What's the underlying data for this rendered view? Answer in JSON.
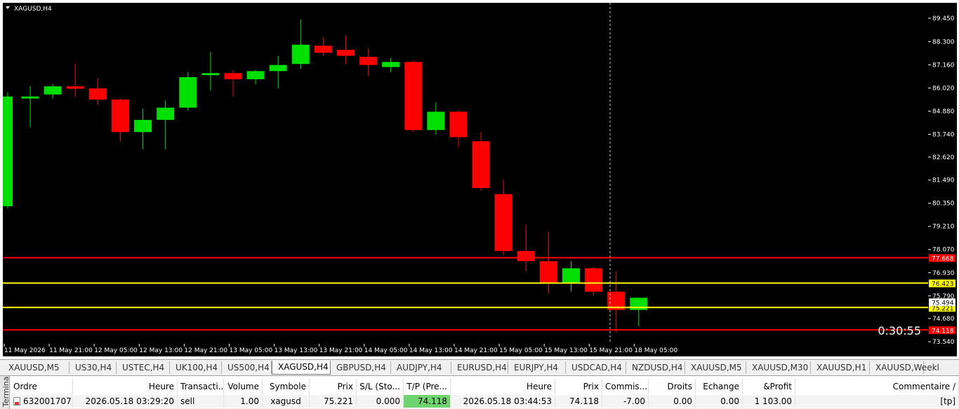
{
  "chart": {
    "title": "XAGUSD,H4",
    "countdown": "0:30:55",
    "background": "#000000",
    "up_color": "#00e000",
    "down_color": "#ff0000",
    "price_labels": [
      "89.450",
      "88.300",
      "87.160",
      "86.020",
      "84.880",
      "83.740",
      "82.620",
      "81.490",
      "80.350",
      "79.210",
      "78.070",
      "76.930",
      "75.790",
      "74.680",
      "73.540"
    ],
    "time_labels": [
      "11 May 2026",
      "11 May 21:00",
      "12 May 05:00",
      "12 May 13:00",
      "12 May 21:00",
      "13 May 05:00",
      "13 May 13:00",
      "13 May 21:00",
      "14 May 05:00",
      "14 May 13:00",
      "14 May 21:00",
      "15 May 05:00",
      "15 May 13:00",
      "15 May 21:00",
      "18 May 05:00"
    ],
    "level_lines": [
      {
        "price": 77.668,
        "label": "77.668",
        "color": "#ff0000",
        "label_bg": "#ff0000",
        "label_fg": "#ffffff"
      },
      {
        "price": 76.423,
        "label": "76.423",
        "color": "#ffff00",
        "label_bg": "#ffff00",
        "label_fg": "#000000"
      },
      {
        "price": 75.221,
        "label": "75.221",
        "color": "#ffff00",
        "label_bg": "#ffff00",
        "label_fg": "#000000"
      },
      {
        "price": 74.118,
        "label": "74.118",
        "color": "#ff0000",
        "label_bg": "#ff0000",
        "label_fg": "#ffffff"
      }
    ],
    "bid_label": "75.494",
    "bid_price": 75.494
  },
  "chart_data": {
    "type": "candlestick",
    "symbol": "XAGUSD",
    "timeframe": "H4",
    "ylim": [
      73.54,
      89.45
    ],
    "candles": [
      {
        "o": 80.2,
        "h": 85.8,
        "l": 80.1,
        "c": 85.6
      },
      {
        "o": 85.5,
        "h": 86.1,
        "l": 84.1,
        "c": 85.6
      },
      {
        "o": 85.7,
        "h": 86.2,
        "l": 85.5,
        "c": 86.1
      },
      {
        "o": 86.1,
        "h": 87.2,
        "l": 85.6,
        "c": 85.98
      },
      {
        "o": 86.0,
        "h": 86.5,
        "l": 85.2,
        "c": 85.45
      },
      {
        "o": 85.45,
        "h": 85.5,
        "l": 83.4,
        "c": 83.85
      },
      {
        "o": 83.85,
        "h": 85.0,
        "l": 83.0,
        "c": 84.45
      },
      {
        "o": 84.45,
        "h": 85.4,
        "l": 83.0,
        "c": 85.05
      },
      {
        "o": 85.05,
        "h": 86.8,
        "l": 84.9,
        "c": 86.55
      },
      {
        "o": 86.65,
        "h": 87.8,
        "l": 85.9,
        "c": 86.75
      },
      {
        "o": 86.75,
        "h": 86.9,
        "l": 85.6,
        "c": 86.45
      },
      {
        "o": 86.45,
        "h": 86.9,
        "l": 86.2,
        "c": 86.85
      },
      {
        "o": 86.85,
        "h": 87.6,
        "l": 86.0,
        "c": 87.15
      },
      {
        "o": 87.2,
        "h": 89.4,
        "l": 86.95,
        "c": 88.15
      },
      {
        "o": 88.1,
        "h": 88.5,
        "l": 87.6,
        "c": 87.75
      },
      {
        "o": 87.9,
        "h": 88.6,
        "l": 87.2,
        "c": 87.6
      },
      {
        "o": 87.55,
        "h": 87.95,
        "l": 86.6,
        "c": 87.15
      },
      {
        "o": 87.05,
        "h": 87.5,
        "l": 86.8,
        "c": 87.3
      },
      {
        "o": 87.3,
        "h": 87.4,
        "l": 83.85,
        "c": 83.95
      },
      {
        "o": 83.95,
        "h": 85.3,
        "l": 83.7,
        "c": 84.85
      },
      {
        "o": 84.85,
        "h": 84.95,
        "l": 83.1,
        "c": 83.6
      },
      {
        "o": 83.4,
        "h": 83.85,
        "l": 80.95,
        "c": 81.1
      },
      {
        "o": 80.8,
        "h": 81.5,
        "l": 77.8,
        "c": 78.0
      },
      {
        "o": 78.0,
        "h": 79.3,
        "l": 77.0,
        "c": 77.5
      },
      {
        "o": 77.5,
        "h": 78.95,
        "l": 75.9,
        "c": 76.45
      },
      {
        "o": 76.45,
        "h": 77.5,
        "l": 76.0,
        "c": 77.15
      },
      {
        "o": 77.15,
        "h": 77.2,
        "l": 75.8,
        "c": 76.0
      },
      {
        "o": 76.0,
        "h": 77.0,
        "l": 74.0,
        "c": 75.1
      },
      {
        "o": 75.1,
        "h": 75.5,
        "l": 74.3,
        "c": 75.7
      }
    ]
  },
  "tabs": [
    "XAUUSD,M5",
    "US30,H4",
    "USTEC,H4",
    "UK100,H4",
    "US500,H4",
    "XAGUSD,H4",
    "GBPUSD,H4",
    "AUDJPY,H4",
    "EURUSD,H4",
    "EURJPY,H4",
    "USDCAD,H4",
    "NZDUSD,H4",
    "XAUUSD,M5",
    "XAUUSD,M30",
    "XAUUSD,H1",
    "XAUUSD,Weekl"
  ],
  "active_tab_index": 5,
  "terminal": {
    "side_label": "Terminal",
    "headers": [
      "Ordre",
      "Heure",
      "Transacti...",
      "Volume",
      "Symbole",
      "Prix",
      "S/L (Sto...",
      "T/P (Pre...",
      "Heure",
      "Prix",
      "Commis...",
      "Droits",
      "Echange",
      "&Profit",
      "Commentaire"
    ],
    "sort_marker": "/",
    "row": [
      "632001707",
      "2026.05.18 03:29:20",
      "sell",
      "1.00",
      "xagusd",
      "75.221",
      "0.000",
      "74.118",
      "2026.05.18 03:44:53",
      "74.118",
      "-7.00",
      "0.00",
      "0.00",
      "1 103.00",
      "[tp]"
    ]
  }
}
